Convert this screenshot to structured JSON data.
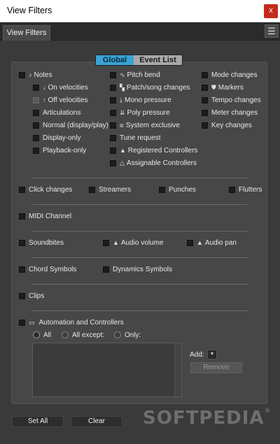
{
  "window": {
    "title": "View Filters",
    "close_label": "x"
  },
  "tab": {
    "label": "View Filters",
    "menu_icon": "☰"
  },
  "segment": {
    "global": "Global",
    "event_list": "Event List"
  },
  "col1": {
    "notes": "Notes",
    "on_velocities": "On velocities",
    "off_velocities": "Off velocities",
    "articulations": "Articulations",
    "normal": "Normal (display/play)",
    "display_only": "Display-only",
    "playback_only": "Playback-only"
  },
  "col2": {
    "pitch_bend": "Pitch bend",
    "patch_song": "Patch/song changes",
    "mono_pressure": "Mono pressure",
    "poly_pressure": "Poly pressure",
    "system_exclusive": "System exclusive",
    "tune_request": "Tune request",
    "registered": "Registered Controllers",
    "assignable": "Assignable Controllers"
  },
  "col3": {
    "mode_changes": "Mode changes",
    "markers": "Markers",
    "tempo_changes": "Tempo changes",
    "meter_changes": "Meter changes",
    "key_changes": "Key changes"
  },
  "row_clicks": {
    "click_changes": "Click changes",
    "streamers": "Streamers",
    "punches": "Punches",
    "flutters": "Flutters"
  },
  "midi_channel": "MIDI Channel",
  "audio": {
    "soundbites": "Soundbites",
    "audio_volume": "Audio volume",
    "audio_pan": "Audio pan"
  },
  "symbols": {
    "chord": "Chord Symbols",
    "dynamics": "Dynamics Symbols"
  },
  "clips": "Clips",
  "automation": {
    "label": "Automation and Controllers",
    "all": "All",
    "all_except": "All except:",
    "only": "Only:",
    "add_label": "Add:",
    "remove": "Remove"
  },
  "footer": {
    "set_all": "Set All",
    "clear": "Clear",
    "watermark": "SOFTPEDIA",
    "watermark_mark": "®"
  }
}
